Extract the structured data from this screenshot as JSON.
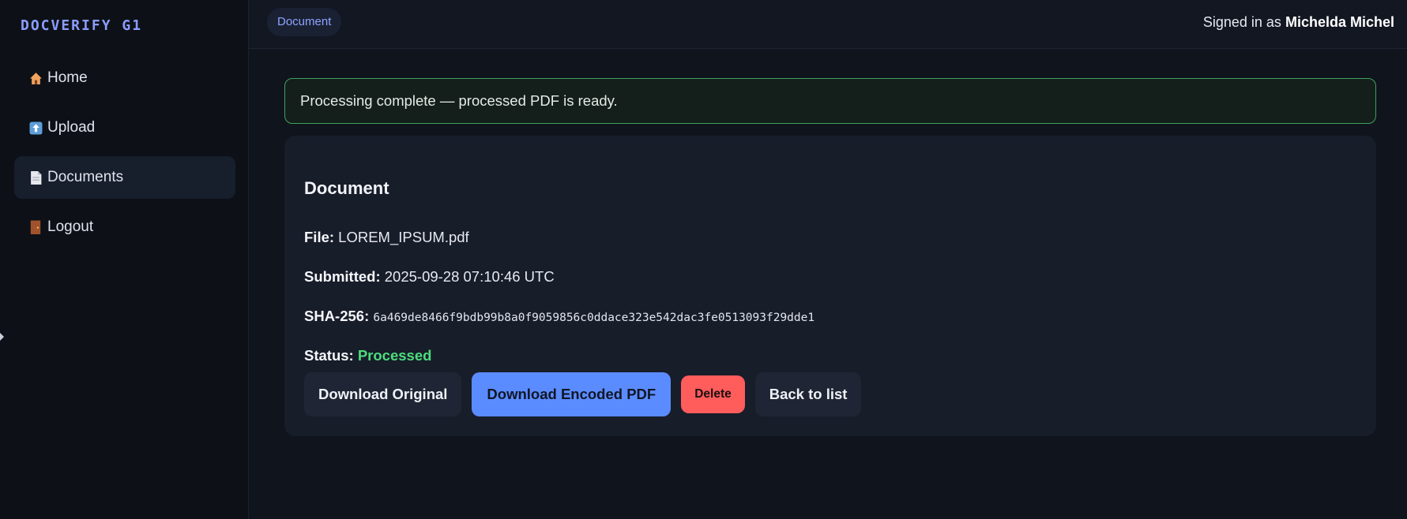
{
  "brand": "DOCVERIFY G1",
  "nav": [
    {
      "icon": "house-icon",
      "label": "Home"
    },
    {
      "icon": "upload-icon",
      "label": "Upload"
    },
    {
      "icon": "document-icon",
      "label": "Documents",
      "active": true
    },
    {
      "icon": "door-icon",
      "label": "Logout"
    }
  ],
  "topbar": {
    "breadcrumb": "Document",
    "signed_in_prefix": "Signed in as",
    "user_name": "Michelda Michel"
  },
  "alert": {
    "message": "Processing complete — processed PDF is ready.",
    "color": "#3f9f5f"
  },
  "document": {
    "heading": "Document",
    "file_label": "File:",
    "file_value": "LOREM_IPSUM.pdf",
    "submitted_label": "Submitted:",
    "submitted_value": "2025-09-28 07:10:46 UTC",
    "sha_label": "SHA-256:",
    "sha_value": "6a469de8466f9bdb99b8a0f9059856c0ddace323e542dac3fe0513093f29dde1",
    "status_label": "Status:",
    "status_value": "Processed",
    "status_color": "#4ddc7c"
  },
  "actions": {
    "download_original": "Download Original",
    "download_encoded": "Download Encoded PDF",
    "delete": "Delete",
    "back": "Back to list"
  },
  "colors": {
    "accent": "#8b9cff",
    "primary": "#5b8cff",
    "danger": "#ff5c5c"
  }
}
